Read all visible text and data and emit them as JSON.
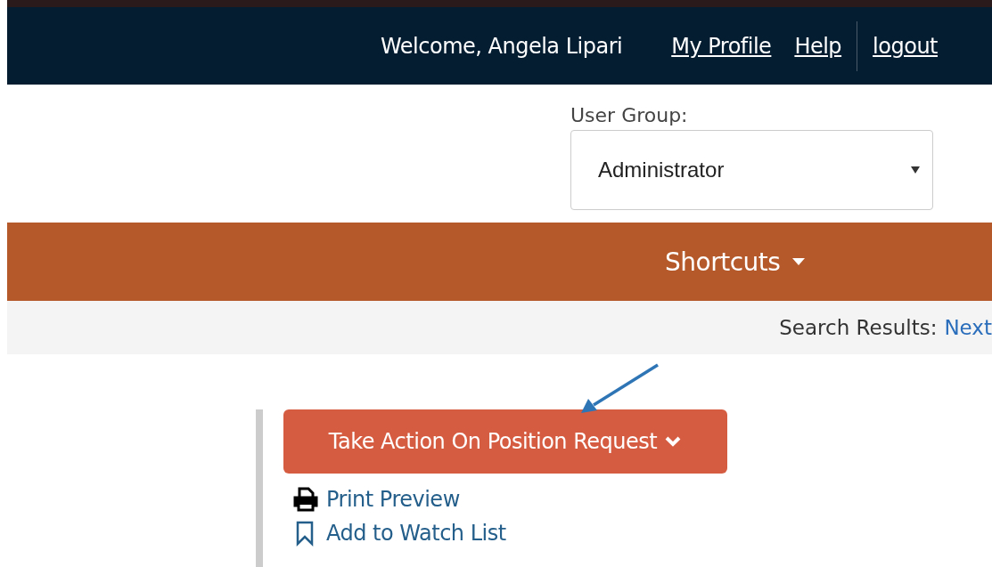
{
  "header": {
    "welcome": "Welcome, Angela Lipari",
    "links": [
      "My Profile",
      "Help",
      "logout"
    ]
  },
  "user_group": {
    "label": "User Group:",
    "value": "Administrator"
  },
  "nav": {
    "label": "Shortcuts"
  },
  "search_results": {
    "label": "Search Results:",
    "link": "Next"
  },
  "actions": {
    "button": "Take Action On Position Request",
    "links": [
      {
        "kind": "print",
        "label": "Print Preview"
      },
      {
        "kind": "watch",
        "label": "Add to Watch List"
      }
    ]
  }
}
